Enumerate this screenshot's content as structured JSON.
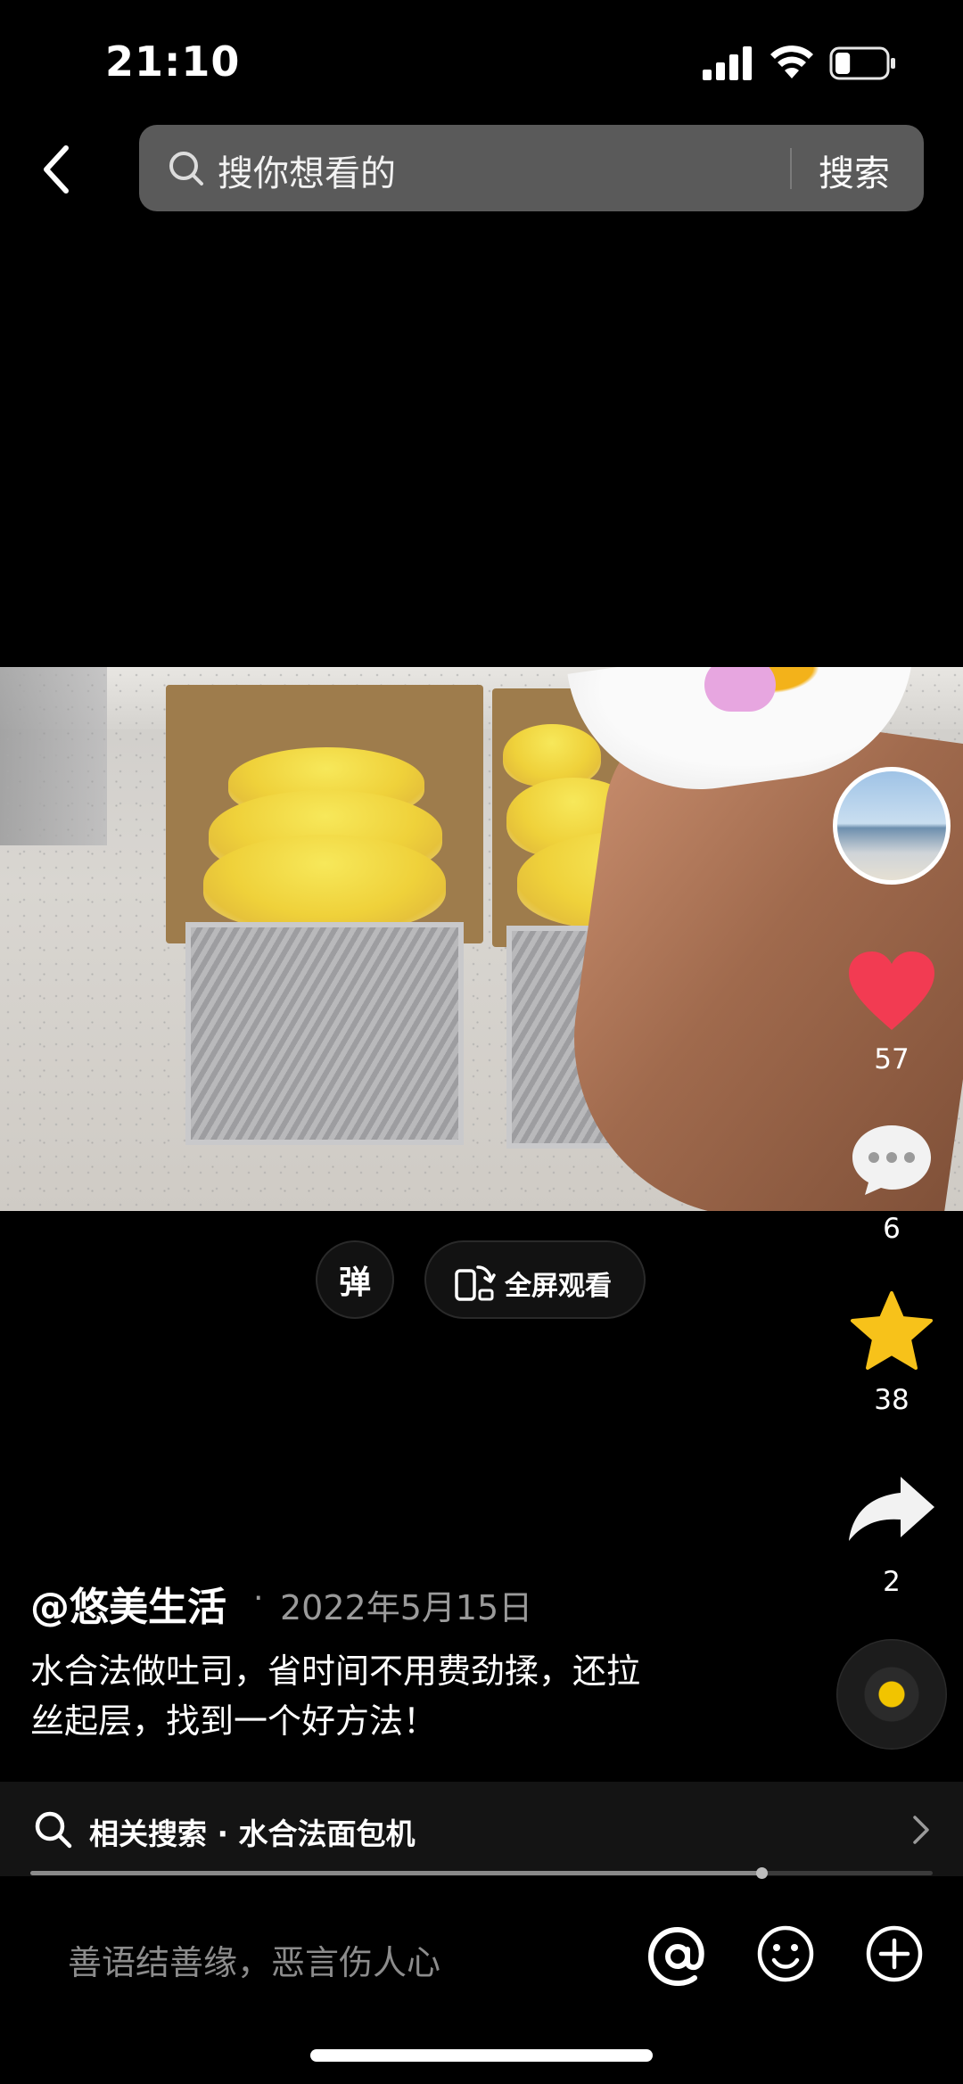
{
  "status_bar": {
    "time": "21:10",
    "battery_level": 0.3
  },
  "header": {
    "search_placeholder": "搜你想看的",
    "search_button": "搜索"
  },
  "video": {
    "description": "two loaf pans of yellow egg-washed dough"
  },
  "actions": {
    "likes": "57",
    "comments": "6",
    "favorites": "38",
    "shares": "2",
    "like_color": "#f23b52",
    "favorite_color": "#f7c21a"
  },
  "overlay": {
    "danmaku_label": "弹",
    "fullscreen_label": "全屏观看"
  },
  "post": {
    "author": "@悠美生活",
    "separator": "·",
    "date": "2022年5月15日",
    "caption_line1": "水合法做吐司，省时间不用费劲揉，还拉",
    "caption_line2": "丝起层，找到一个好方法！"
  },
  "related_search": {
    "label": "相关搜索 · 水合法面包机"
  },
  "playback": {
    "progress": 0.81
  },
  "comment_bar": {
    "placeholder": "善语结善缘，恶言伤人心"
  }
}
